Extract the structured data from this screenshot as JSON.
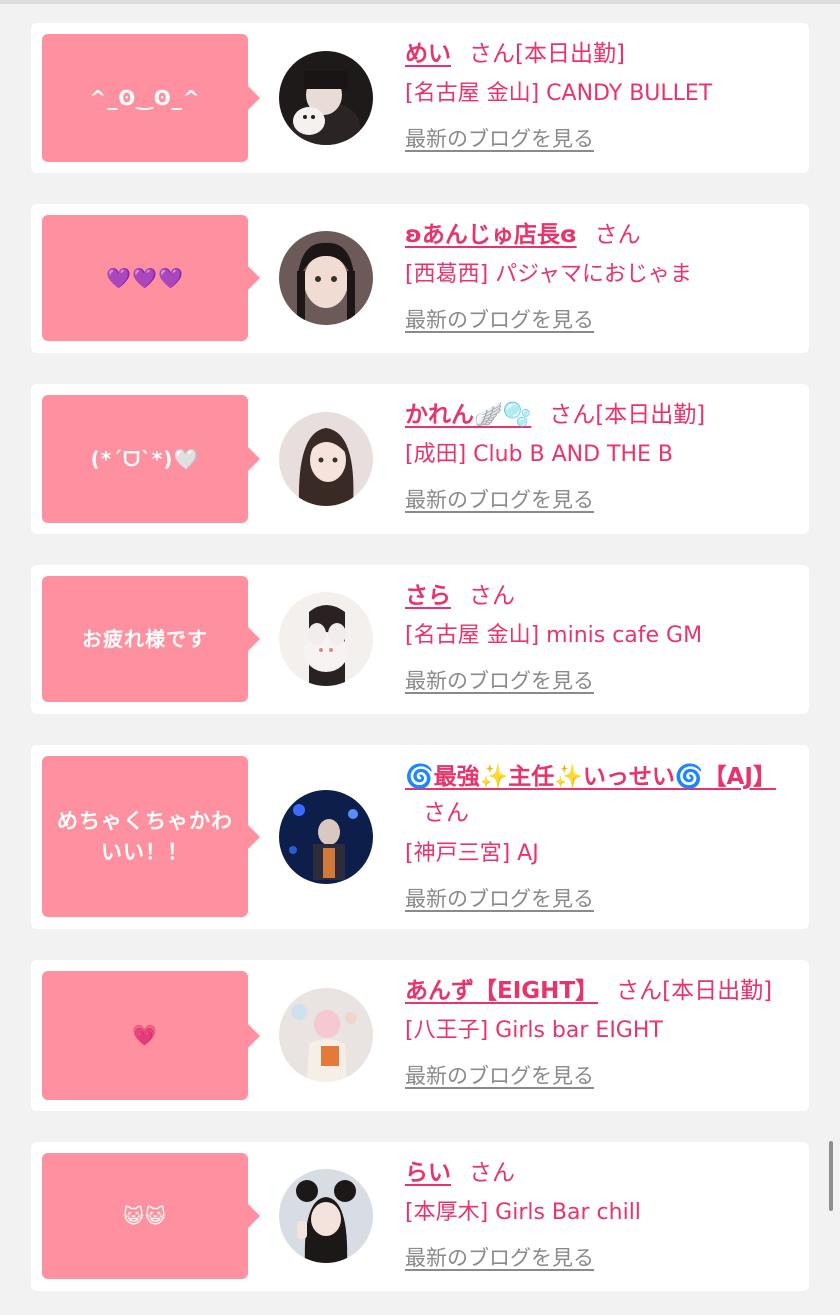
{
  "blog_link_label": "最新のブログを見る",
  "san_label": "さん",
  "entries": [
    {
      "comment": "^_ʘ‿ʘ_^",
      "name": "めい",
      "status": "[本日出勤]",
      "shop": "[名古屋 金山] CANDY BULLET",
      "avatar": "girl-with-white-cat-photo"
    },
    {
      "comment": "💜💜💜",
      "name": "ʚあんじゅ店長ɞ",
      "status": "",
      "shop": "[西葛西] パジャマにおじゃま",
      "avatar": "girl-with-dark-hair-photo"
    },
    {
      "comment": "(*ˊᗜˋ*)🤍",
      "name": "かれん🪽🫧",
      "status": "[本日出勤]",
      "shop": "[成田] Club B AND THE B",
      "avatar": "girl-with-long-hair-photo"
    },
    {
      "comment": "お疲れ様です",
      "name": "さら",
      "status": "",
      "shop": "[名古屋 金山] minis cafe GM",
      "avatar": "girl-with-plush-toy-photo"
    },
    {
      "comment": "めちゃくちゃかわいい！！",
      "name": "🌀最強✨主任✨いっせい🌀【AJ】",
      "status": "",
      "shop": "[神戸三宮] AJ",
      "avatar": "person-in-blue-lit-room-photo"
    },
    {
      "comment": "💗",
      "name": "あんず【EIGHT】",
      "status": "[本日出勤]",
      "shop": "[八王子] Girls bar EIGHT",
      "avatar": "girl-with-drink-photo"
    },
    {
      "comment": "😺😺",
      "name": "らい",
      "status": "",
      "shop": "[本厚木] Girls Bar chill",
      "avatar": "girl-peace-sign-photo"
    }
  ]
}
